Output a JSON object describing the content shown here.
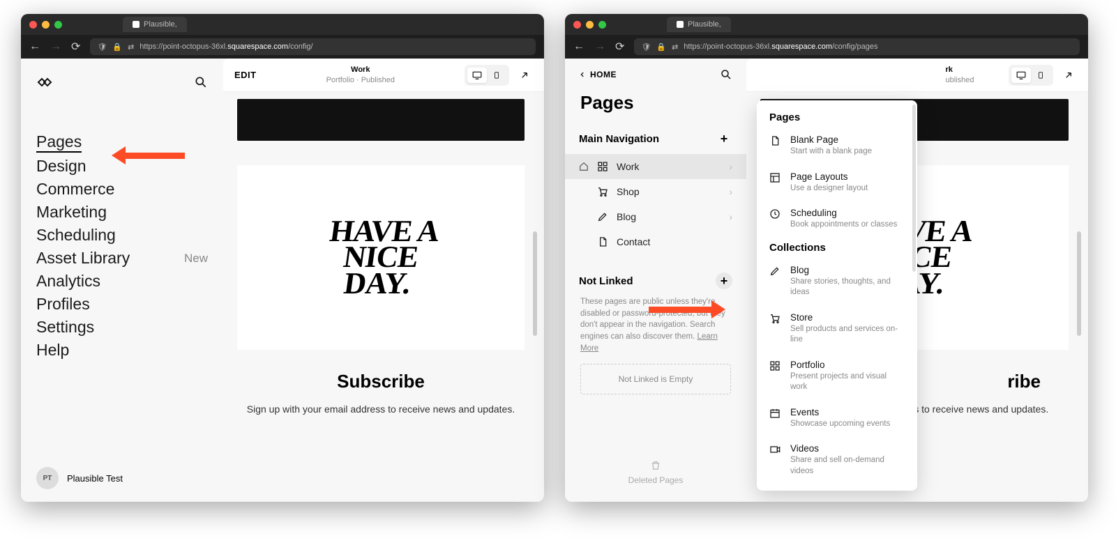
{
  "browser": {
    "tab_label": "Plausible,",
    "url_left": "https://point-octopus-36xl.",
    "url_bold": "squarespace.com",
    "url_path_left": "/config/",
    "url_path_right": "/config/pages"
  },
  "left": {
    "nav": [
      "Pages",
      "Design",
      "Commerce",
      "Marketing",
      "Scheduling",
      "Asset Library",
      "Analytics",
      "Profiles",
      "Settings",
      "Help"
    ],
    "new_badge": "New",
    "user_initials": "PT",
    "user_name": "Plausible Test"
  },
  "preview": {
    "edit": "EDIT",
    "title": "Work",
    "subtitle": "Portfolio · Published",
    "script_text": "HAVE A\nNICE\nDAY.",
    "sub_heading": "Subscribe",
    "sub_text": "Sign up with your email address to receive news and updates."
  },
  "right": {
    "home": "HOME",
    "pages_heading": "Pages",
    "main_nav_label": "Main Navigation",
    "pages": [
      {
        "label": "Work",
        "icon": "grid",
        "home": true,
        "arrow": true,
        "selected": true
      },
      {
        "label": "Shop",
        "icon": "cart",
        "home": false,
        "arrow": true,
        "selected": false
      },
      {
        "label": "Blog",
        "icon": "pen",
        "home": false,
        "arrow": true,
        "selected": false
      },
      {
        "label": "Contact",
        "icon": "doc",
        "home": false,
        "arrow": false,
        "selected": false
      }
    ],
    "not_linked_label": "Not Linked",
    "not_linked_desc": "These pages are public unless they're disabled or password-protected, but they don't appear in the navigation. Search engines can also discover them. ",
    "learn_more": "Learn More",
    "empty_text": "Not Linked is Empty",
    "deleted_label": "Deleted Pages"
  },
  "popover": {
    "heading_pages": "Pages",
    "heading_collections": "Collections",
    "items_pages": [
      {
        "title": "Blank Page",
        "desc": "Start with a blank page",
        "icon": "doc"
      },
      {
        "title": "Page Layouts",
        "desc": "Use a designer layout",
        "icon": "layout"
      },
      {
        "title": "Scheduling",
        "desc": "Book appointments or classes",
        "icon": "clock"
      }
    ],
    "items_collections": [
      {
        "title": "Blog",
        "desc": "Share stories, thoughts, and ideas",
        "icon": "pen"
      },
      {
        "title": "Store",
        "desc": "Sell products and services on-line",
        "icon": "cart"
      },
      {
        "title": "Portfolio",
        "desc": "Present projects and visual work",
        "icon": "grid"
      },
      {
        "title": "Events",
        "desc": "Showcase upcoming events",
        "icon": "calendar"
      },
      {
        "title": "Videos",
        "desc": "Share and sell on-demand videos",
        "icon": "video"
      }
    ]
  },
  "preview_r": {
    "title_end": "rk",
    "subtitle_end": "ublished",
    "sub_heading_cut": "ribe"
  }
}
